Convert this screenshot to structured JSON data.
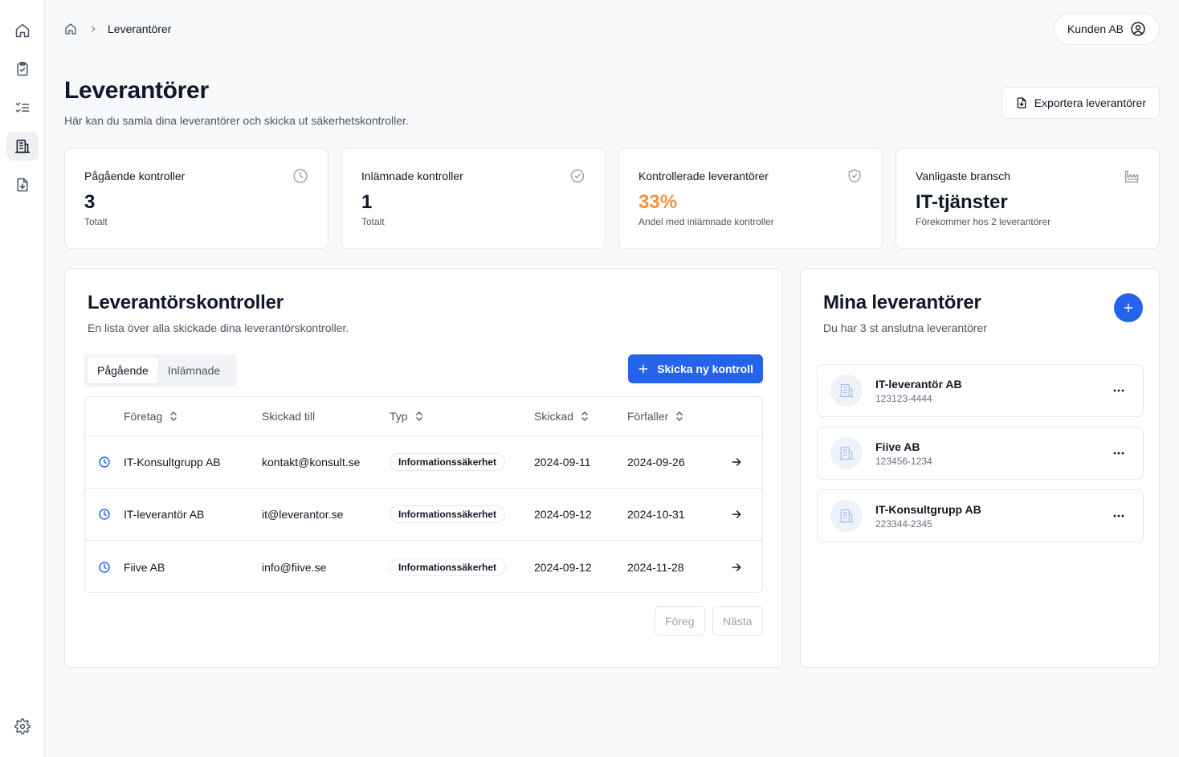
{
  "breadcrumb": {
    "current": "Leverantörer"
  },
  "user": {
    "name": "Kunden AB"
  },
  "page": {
    "title": "Leverantörer",
    "subtitle": "Här kan du samla dina leverantörer och skicka ut säkerhetskontroller.",
    "export_label": "Exportera leverantörer"
  },
  "stats": [
    {
      "title": "Pågående kontroller",
      "value": "3",
      "sub": "Totalt",
      "icon": "clock-icon"
    },
    {
      "title": "Inlämnade kontroller",
      "value": "1",
      "sub": "Totalt",
      "icon": "check-circle-icon"
    },
    {
      "title": "Kontrollerade leverantörer",
      "value": "33%",
      "sub": "Andel med inlämnade kontroller",
      "icon": "shield-check-icon",
      "value_color": "#f5923e"
    },
    {
      "title": "Vanligaste bransch",
      "value": "IT-tjänster",
      "sub": "Förekommer hos 2 leverantörer",
      "icon": "factory-icon"
    }
  ],
  "controls": {
    "title": "Leverantörskontroller",
    "subtitle": "En lista över alla skickade dina leverantörskontroller.",
    "tabs": [
      "Pågående",
      "Inlämnade"
    ],
    "active_tab": "Pågående",
    "send_label": "Skicka ny kontroll",
    "columns": [
      "Företag",
      "Skickad till",
      "Typ",
      "Skickad",
      "Förfaller"
    ],
    "rows": [
      {
        "company": "IT-Konsultgrupp AB",
        "email": "kontakt@konsult.se",
        "type": "Informationssäkerhet",
        "sent": "2024-09-11",
        "due": "2024-09-26"
      },
      {
        "company": "IT-leverantör AB",
        "email": "it@leverantor.se",
        "type": "Informationssäkerhet",
        "sent": "2024-09-12",
        "due": "2024-10-31"
      },
      {
        "company": "Fiive AB",
        "email": "info@fiive.se",
        "type": "Informationssäkerhet",
        "sent": "2024-09-12",
        "due": "2024-11-28"
      }
    ],
    "prev_label": "Föreg",
    "next_label": "Nästa"
  },
  "suppliers": {
    "title": "Mina leverantörer",
    "subtitle": "Du har 3 st anslutna leverantörer",
    "items": [
      {
        "name": "IT-leverantör AB",
        "org": "123123-4444"
      },
      {
        "name": "Fiive AB",
        "org": "123456-1234"
      },
      {
        "name": "IT-Konsultgrupp AB",
        "org": "223344-2345"
      }
    ]
  },
  "colors": {
    "accent": "#2563eb",
    "highlight": "#f5923e"
  }
}
